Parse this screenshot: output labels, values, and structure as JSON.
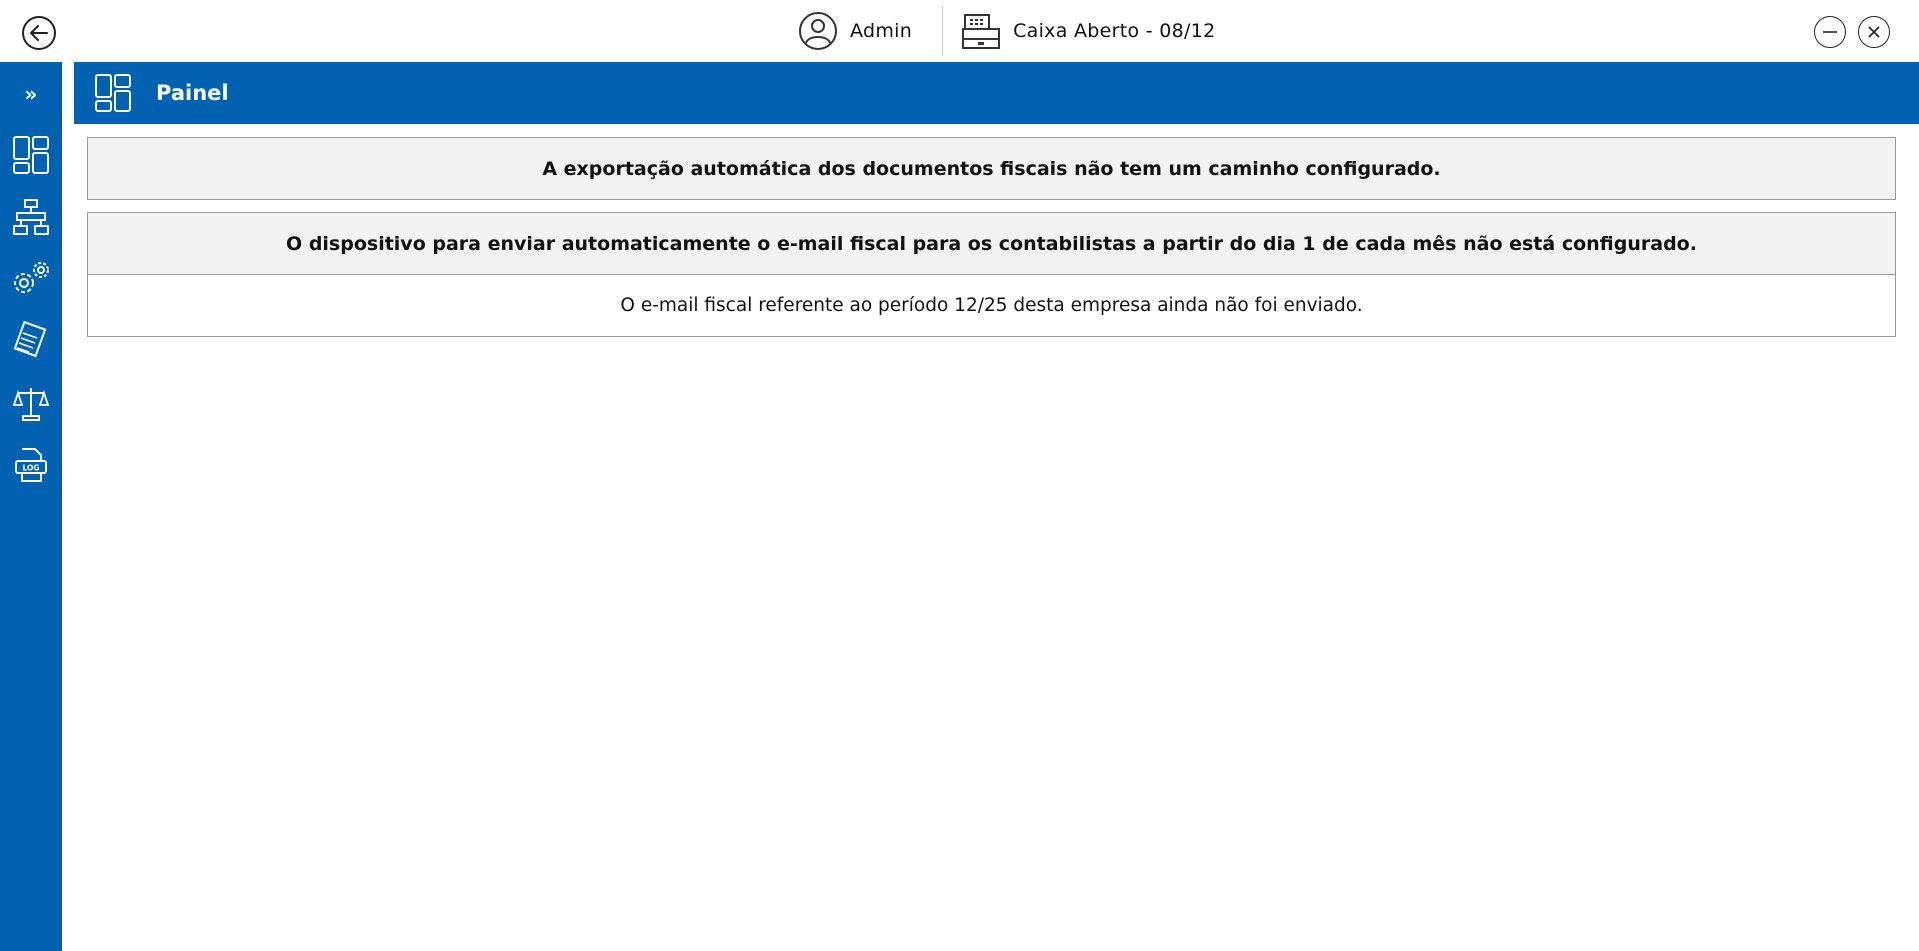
{
  "topbar": {
    "user": "Admin",
    "caixa": "Caixa Aberto - 08/12"
  },
  "sidebar": {
    "expand_label": "»",
    "items": [
      {
        "icon": "dashboard-icon"
      },
      {
        "icon": "network-icon"
      },
      {
        "icon": "settings-gears-icon"
      },
      {
        "icon": "documents-icon"
      },
      {
        "icon": "scales-icon"
      },
      {
        "icon": "log-file-icon"
      }
    ]
  },
  "header": {
    "title": "Painel"
  },
  "notices": [
    {
      "text": "A exportação automática dos documentos fiscais não tem um caminho configurado."
    },
    {
      "text": "O dispositivo para enviar automaticamente o e-mail fiscal para os contabilistas a partir do dia 1 de cada mês não está configurado."
    },
    {
      "text": "O e-mail fiscal referente ao período 12/25 desta empresa ainda não foi enviado."
    }
  ],
  "colors": {
    "accent": "#0062b1",
    "notice_bg": "#f2f2f2",
    "border": "#9a9a9a"
  }
}
